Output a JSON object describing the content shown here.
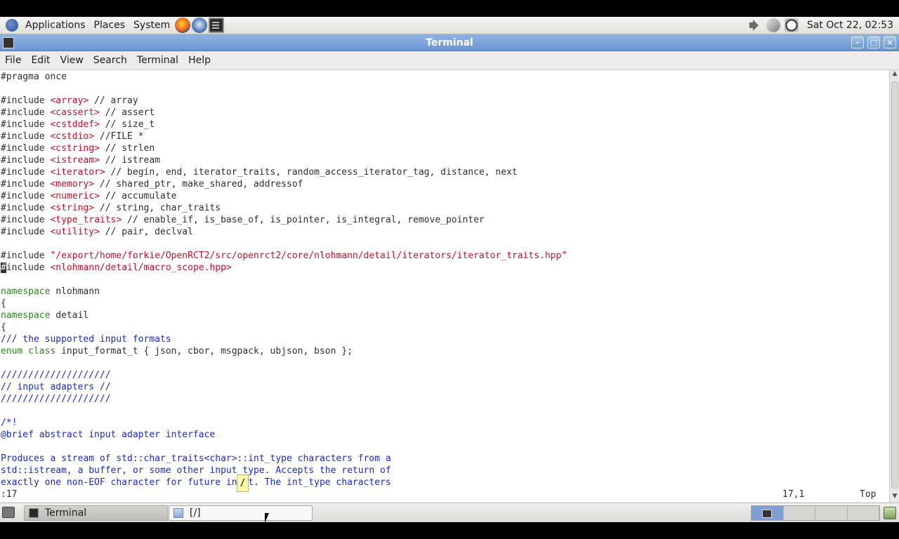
{
  "top_panel": {
    "menus": [
      "Applications",
      "Places",
      "System"
    ],
    "clock": "Sat Oct 22, 02:53"
  },
  "window": {
    "title": "Terminal",
    "menu": [
      "File",
      "Edit",
      "View",
      "Search",
      "Terminal",
      "Help"
    ]
  },
  "editor": {
    "lines": [
      [
        {
          "t": "#pragma once",
          "c": ""
        }
      ],
      [],
      [
        {
          "t": "#include ",
          "c": ""
        },
        {
          "t": "<array>",
          "c": "red"
        },
        {
          "t": " // array",
          "c": ""
        }
      ],
      [
        {
          "t": "#include ",
          "c": ""
        },
        {
          "t": "<cassert>",
          "c": "red"
        },
        {
          "t": " // assert",
          "c": ""
        }
      ],
      [
        {
          "t": "#include ",
          "c": ""
        },
        {
          "t": "<cstddef>",
          "c": "red"
        },
        {
          "t": " // size_t",
          "c": ""
        }
      ],
      [
        {
          "t": "#include ",
          "c": ""
        },
        {
          "t": "<cstdio>",
          "c": "red"
        },
        {
          "t": " //FILE *",
          "c": ""
        }
      ],
      [
        {
          "t": "#include ",
          "c": ""
        },
        {
          "t": "<cstring>",
          "c": "red"
        },
        {
          "t": " // strlen",
          "c": ""
        }
      ],
      [
        {
          "t": "#include ",
          "c": ""
        },
        {
          "t": "<istream>",
          "c": "red"
        },
        {
          "t": " // istream",
          "c": ""
        }
      ],
      [
        {
          "t": "#include ",
          "c": ""
        },
        {
          "t": "<iterator>",
          "c": "red"
        },
        {
          "t": " // begin, end, iterator_traits, random_access_iterator_tag, distance, next",
          "c": ""
        }
      ],
      [
        {
          "t": "#include ",
          "c": ""
        },
        {
          "t": "<memory>",
          "c": "red"
        },
        {
          "t": " // shared_ptr, make_shared, addressof",
          "c": ""
        }
      ],
      [
        {
          "t": "#include ",
          "c": ""
        },
        {
          "t": "<numeric>",
          "c": "red"
        },
        {
          "t": " // accumulate",
          "c": ""
        }
      ],
      [
        {
          "t": "#include ",
          "c": ""
        },
        {
          "t": "<string>",
          "c": "red"
        },
        {
          "t": " // string, char_traits",
          "c": ""
        }
      ],
      [
        {
          "t": "#include ",
          "c": ""
        },
        {
          "t": "<type_traits>",
          "c": "red"
        },
        {
          "t": " // enable_if, is_base_of, is_pointer, is_integral, remove_pointer",
          "c": ""
        }
      ],
      [
        {
          "t": "#include ",
          "c": ""
        },
        {
          "t": "<utility>",
          "c": "red"
        },
        {
          "t": " // pair, declval",
          "c": ""
        }
      ],
      [],
      [
        {
          "t": "#include ",
          "c": ""
        },
        {
          "t": "\"/export/home/forkie/OpenRCT2/src/openrct2/core/nlohmann/detail/iterators/iterator_traits.hpp\"",
          "c": "red"
        }
      ],
      [
        {
          "t": "#",
          "c": "cursor"
        },
        {
          "t": "include ",
          "c": ""
        },
        {
          "t": "<nlohmann/detail/macro_scope.hpp>",
          "c": "red"
        }
      ],
      [],
      [
        {
          "t": "namespace",
          "c": "grn"
        },
        {
          "t": " nlohmann",
          "c": ""
        }
      ],
      [
        {
          "t": "{",
          "c": ""
        }
      ],
      [
        {
          "t": "namespace",
          "c": "grn"
        },
        {
          "t": " detail",
          "c": ""
        }
      ],
      [
        {
          "t": "{",
          "c": ""
        }
      ],
      [
        {
          "t": "/// the supported input formats",
          "c": "blu"
        }
      ],
      [
        {
          "t": "enum class",
          "c": "grn"
        },
        {
          "t": " input_format_t { json, cbor, msgpack, ubjson, bson };",
          "c": ""
        }
      ],
      [],
      [
        {
          "t": "////////////////////",
          "c": "blu"
        }
      ],
      [
        {
          "t": "// input adapters //",
          "c": "blu"
        }
      ],
      [
        {
          "t": "////////////////////",
          "c": "blu"
        }
      ],
      [],
      [
        {
          "t": "/*!",
          "c": "blu"
        }
      ],
      [
        {
          "t": "@brief abstract input adapter interface",
          "c": "blu"
        }
      ],
      [],
      [
        {
          "t": "Produces a stream of std::char_traits<char>::int_type characters from a",
          "c": "blu"
        }
      ],
      [
        {
          "t": "std::istream, a buffer, or some other input type. Accepts the return of",
          "c": "blu"
        }
      ],
      [
        {
          "t": "exactly one non-EOF character for future input. The int_type characters",
          "c": "blu"
        }
      ]
    ],
    "status_cmd": ":17",
    "status_pos": "17,1",
    "status_top": "Top",
    "tooltip": "/"
  },
  "taskbar": {
    "task1": "Terminal",
    "task2": "[/]"
  }
}
